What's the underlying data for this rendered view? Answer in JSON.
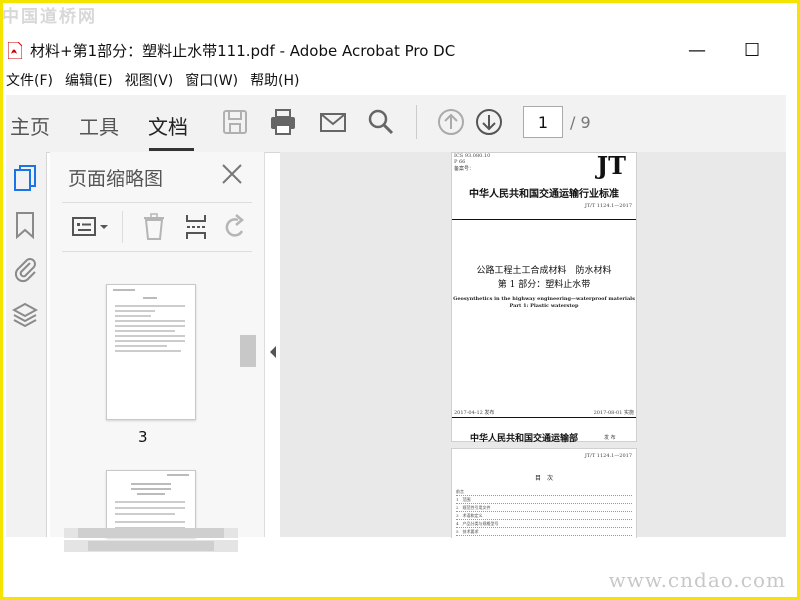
{
  "watermark_top": "中国道桥网",
  "watermark_bottom": "www.cndao.com",
  "window": {
    "title": "材料+第1部分：塑料止水带111.pdf - Adobe Acrobat Pro DC",
    "minimize": "—",
    "maximize": "☐"
  },
  "menu": [
    "文件(F)",
    "编辑(E)",
    "视图(V)",
    "窗口(W)",
    "帮助(H)"
  ],
  "toolbar": {
    "tabs": [
      "主页",
      "工具",
      "文档"
    ],
    "active_tab": "文档",
    "page_current": "1",
    "page_total": "/ 9",
    "icons": [
      "save-icon",
      "print-icon",
      "email-icon",
      "search-icon",
      "page-up-icon",
      "page-down-icon"
    ]
  },
  "left_rail": {
    "icons": [
      "page-thumbnails-icon",
      "bookmark-icon",
      "attachment-icon",
      "layers-icon"
    ]
  },
  "thumbnail_panel": {
    "title": "页面缩略图",
    "tool_icons": [
      "thumbnail-options-icon",
      "delete-icon",
      "insert-page-icon",
      "rotate-icon"
    ],
    "visible_pages": [
      {
        "label": "3"
      },
      {
        "label": ""
      }
    ]
  },
  "document": {
    "header_left": [
      "ICS 93.080.10",
      "P 66",
      "备案号："
    ],
    "logo": "JT",
    "standard_name": "中华人民共和国交通运输行业标准",
    "standard_no": "JT/T 1124.1—2017",
    "title_cn_line1": "公路工程土工合成材料　防水材料",
    "title_cn_line2": "第 1 部分：塑料止水带",
    "title_en_line1": "Geosynthetics in the highway engineering—waterproof materials",
    "title_en_line2": "Part 1: Plastic waterstop",
    "issue_date": "2017-04-12 发布",
    "impl_date": "2017-08-01 实施",
    "issuer": "中华人民共和国交通运输部",
    "issuer_suffix": "发 布",
    "page2_header": "JT/T 1124.1—2017",
    "toc_title": "目　次",
    "toc_rows": [
      "前言",
      "1　范围",
      "2　规范性引用文件",
      "3　术语和定义",
      "4　产品分类与规格型号",
      "5　技术要求"
    ]
  },
  "colors": {
    "frame": "#f5e400",
    "toolbar_bg": "#f2f2f2",
    "doc_bg": "#e9e9e9",
    "icon_blue": "#1a73e8",
    "icon_gray": "#707070"
  }
}
